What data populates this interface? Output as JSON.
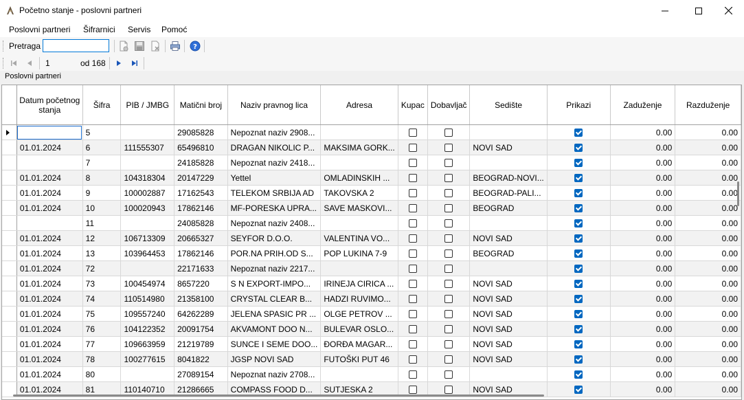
{
  "window": {
    "title": "Početno stanje - poslovni partneri"
  },
  "menu": [
    "Poslovni partneri",
    "Šifrarnici",
    "Servis",
    "Pomoć"
  ],
  "toolbar": {
    "search_label": "Pretraga",
    "search_value": "",
    "icons": [
      "new-document-icon",
      "save-icon",
      "delete-document-icon",
      "print-icon",
      "help-icon"
    ]
  },
  "navigator": {
    "page": "1",
    "of_label": "od 168"
  },
  "group_label": "Poslovni partneri",
  "table": {
    "columns": [
      "Datum početnog stanja",
      "Šifra",
      "PIB / JMBG",
      "Matični broj",
      "Naziv pravnog lica",
      "Adresa",
      "Kupac",
      "Dobavljač",
      "Sedište",
      "Prikazi",
      "Zaduženje",
      "Razduženje"
    ],
    "rows": [
      {
        "datum": "",
        "sifra": "5",
        "pib": "",
        "mb": "29085828",
        "naziv": "Nepoznat naziv 2908...",
        "adresa": "",
        "kupac": false,
        "dobavljac": false,
        "sediste": "",
        "prikazi": true,
        "zaduzenje": "0.00",
        "razduzenje": "0.00"
      },
      {
        "datum": "01.01.2024",
        "sifra": "6",
        "pib": "111555307",
        "mb": "65496810",
        "naziv": "DRAGAN NIKOLIC P...",
        "adresa": "MAKSIMA GORK...",
        "kupac": false,
        "dobavljac": false,
        "sediste": "NOVI SAD",
        "prikazi": true,
        "zaduzenje": "0.00",
        "razduzenje": "0.00"
      },
      {
        "datum": "",
        "sifra": "7",
        "pib": "",
        "mb": "24185828",
        "naziv": "Nepoznat naziv 2418...",
        "adresa": "",
        "kupac": false,
        "dobavljac": false,
        "sediste": "",
        "prikazi": true,
        "zaduzenje": "0.00",
        "razduzenje": "0.00"
      },
      {
        "datum": "01.01.2024",
        "sifra": "8",
        "pib": "104318304",
        "mb": "20147229",
        "naziv": "Yettel",
        "adresa": "OMLADINSKIH ...",
        "kupac": false,
        "dobavljac": false,
        "sediste": "BEOGRAD-NOVI...",
        "prikazi": true,
        "zaduzenje": "0.00",
        "razduzenje": "0.00"
      },
      {
        "datum": "01.01.2024",
        "sifra": "9",
        "pib": "100002887",
        "mb": "17162543",
        "naziv": "TELEKOM SRBIJA AD",
        "adresa": "TAKOVSKA 2",
        "kupac": false,
        "dobavljac": false,
        "sediste": "BEOGRAD-PALI...",
        "prikazi": true,
        "zaduzenje": "0.00",
        "razduzenje": "0.00"
      },
      {
        "datum": "01.01.2024",
        "sifra": "10",
        "pib": "100020943",
        "mb": "17862146",
        "naziv": "MF-PORESKA UPRA...",
        "adresa": "SAVE MASKOVI...",
        "kupac": false,
        "dobavljac": false,
        "sediste": "BEOGRAD",
        "prikazi": true,
        "zaduzenje": "0.00",
        "razduzenje": "0.00"
      },
      {
        "datum": "",
        "sifra": "11",
        "pib": "",
        "mb": "24085828",
        "naziv": "Nepoznat naziv 2408...",
        "adresa": "",
        "kupac": false,
        "dobavljac": false,
        "sediste": "",
        "prikazi": true,
        "zaduzenje": "0.00",
        "razduzenje": "0.00"
      },
      {
        "datum": "01.01.2024",
        "sifra": "12",
        "pib": "106713309",
        "mb": "20665327",
        "naziv": "SEYFOR D.O.O.",
        "adresa": "VALENTINA VO...",
        "kupac": false,
        "dobavljac": false,
        "sediste": "NOVI SAD",
        "prikazi": true,
        "zaduzenje": "0.00",
        "razduzenje": "0.00"
      },
      {
        "datum": "01.01.2024",
        "sifra": "13",
        "pib": "103964453",
        "mb": "17862146",
        "naziv": "POR.NA PRIH.OD S...",
        "adresa": "POP LUKINA 7-9",
        "kupac": false,
        "dobavljac": false,
        "sediste": "BEOGRAD",
        "prikazi": true,
        "zaduzenje": "0.00",
        "razduzenje": "0.00"
      },
      {
        "datum": "01.01.2024",
        "sifra": "72",
        "pib": "",
        "mb": "22171633",
        "naziv": "Nepoznat naziv 2217...",
        "adresa": "",
        "kupac": false,
        "dobavljac": false,
        "sediste": "",
        "prikazi": true,
        "zaduzenje": "0.00",
        "razduzenje": "0.00"
      },
      {
        "datum": "01.01.2024",
        "sifra": "73",
        "pib": "100454974",
        "mb": "8657220",
        "naziv": "S  N EXPORT-IMPO...",
        "adresa": "IRINEJA CIRICA ...",
        "kupac": false,
        "dobavljac": false,
        "sediste": "NOVI SAD",
        "prikazi": true,
        "zaduzenje": "0.00",
        "razduzenje": "0.00"
      },
      {
        "datum": "01.01.2024",
        "sifra": "74",
        "pib": "110514980",
        "mb": "21358100",
        "naziv": "CRYSTAL CLEAR B...",
        "adresa": "HADZI RUVIMO...",
        "kupac": false,
        "dobavljac": false,
        "sediste": "NOVI SAD",
        "prikazi": true,
        "zaduzenje": "0.00",
        "razduzenje": "0.00"
      },
      {
        "datum": "01.01.2024",
        "sifra": "75",
        "pib": "109557240",
        "mb": "64262289",
        "naziv": "JELENA SPASIC PR ...",
        "adresa": "OLGE PETROV ...",
        "kupac": false,
        "dobavljac": false,
        "sediste": "NOVI SAD",
        "prikazi": true,
        "zaduzenje": "0.00",
        "razduzenje": "0.00"
      },
      {
        "datum": "01.01.2024",
        "sifra": "76",
        "pib": "104122352",
        "mb": "20091754",
        "naziv": "AKVAMONT DOO N...",
        "adresa": "BULEVAR OSLO...",
        "kupac": false,
        "dobavljac": false,
        "sediste": "NOVI SAD",
        "prikazi": true,
        "zaduzenje": "0.00",
        "razduzenje": "0.00"
      },
      {
        "datum": "01.01.2024",
        "sifra": "77",
        "pib": "109663959",
        "mb": "21219789",
        "naziv": "SUNCE I SEME DOO...",
        "adresa": "ĐORĐA MAGAR...",
        "kupac": false,
        "dobavljac": false,
        "sediste": "NOVI SAD",
        "prikazi": true,
        "zaduzenje": "0.00",
        "razduzenje": "0.00"
      },
      {
        "datum": "01.01.2024",
        "sifra": "78",
        "pib": "100277615",
        "mb": "8041822",
        "naziv": "JGSP NOVI SAD",
        "adresa": "FUTOŠKI PUT 46",
        "kupac": false,
        "dobavljac": false,
        "sediste": "NOVI SAD",
        "prikazi": true,
        "zaduzenje": "0.00",
        "razduzenje": "0.00"
      },
      {
        "datum": "01.01.2024",
        "sifra": "80",
        "pib": "",
        "mb": "27089154",
        "naziv": "Nepoznat naziv 2708...",
        "adresa": "",
        "kupac": false,
        "dobavljac": false,
        "sediste": "",
        "prikazi": true,
        "zaduzenje": "0.00",
        "razduzenje": "0.00"
      },
      {
        "datum": "01.01.2024",
        "sifra": "81",
        "pib": "110140710",
        "mb": "21286665",
        "naziv": "COMPASS FOOD D...",
        "adresa": "SUTJESKA 2",
        "kupac": false,
        "dobavljac": false,
        "sediste": "NOVI SAD",
        "prikazi": true,
        "zaduzenje": "0.00",
        "razduzenje": "0.00"
      }
    ]
  },
  "colors": {
    "accent": "#0067c0",
    "input_border": "#0078d7",
    "alt_row": "#f2f2f2"
  }
}
